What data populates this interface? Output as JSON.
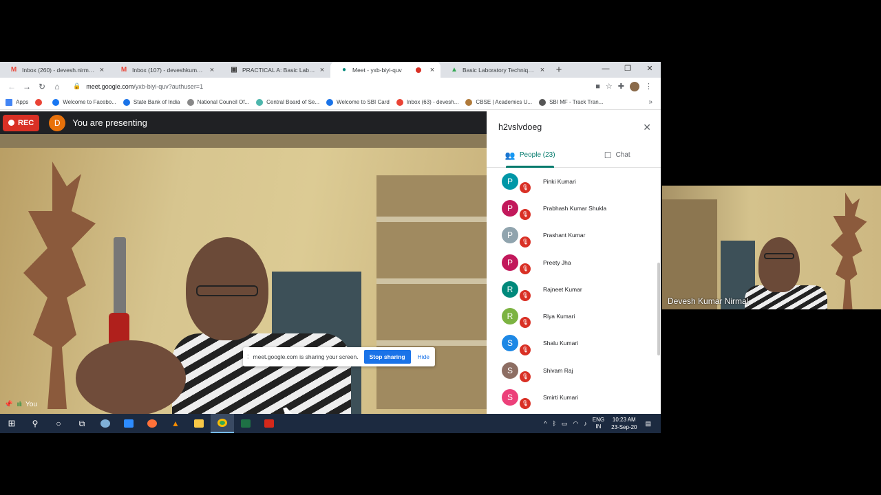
{
  "browser": {
    "tabs": [
      {
        "icon": "gmail-icon",
        "title": "Inbox (260) - devesh.nirmal@g",
        "active": false
      },
      {
        "icon": "gmail-icon",
        "title": "Inbox (107) - deveshkumar.22(",
        "active": false
      },
      {
        "icon": "doc-icon",
        "title": "PRACTICAL A: Basic Laboratory",
        "active": false
      },
      {
        "icon": "meet-icon",
        "title": "Meet - yxb-biyi-quv",
        "active": true,
        "recording": true
      },
      {
        "icon": "drive-icon",
        "title": "Basic Laboratory Techniques (",
        "active": false
      }
    ],
    "url_host": "meet.google.com",
    "url_path": "/yxb-biyi-quv?authuser=1",
    "bookmarks": [
      {
        "label": "Apps",
        "color": "#4285f4"
      },
      {
        "label": "",
        "color": "#ea4335"
      },
      {
        "label": "Welcome to Facebo...",
        "color": "#1877f2"
      },
      {
        "label": "State Bank of India",
        "color": "#1a73e8"
      },
      {
        "label": "National Council Of...",
        "color": "#888888"
      },
      {
        "label": "Central Board of Se...",
        "color": "#4db6ac"
      },
      {
        "label": "Welcome to SBI Card",
        "color": "#1a73e8"
      },
      {
        "label": "Inbox (63) - devesh...",
        "color": "#ea4335"
      },
      {
        "label": "CBSE | Academics U...",
        "color": "#b07a3a"
      },
      {
        "label": "SBI MF - Track Tran...",
        "color": "#555555"
      }
    ]
  },
  "meet": {
    "rec_label": "REC",
    "presenter_initial": "D",
    "presenting_text": "You are presenting",
    "share_notice": "meet.google.com is sharing your screen.",
    "stop_sharing": "Stop sharing",
    "hide": "Hide",
    "self_label": "You",
    "panel": {
      "meeting_code": "h2vslvdoeg",
      "people_tab": "People (23)",
      "chat_tab": "Chat",
      "participants": [
        {
          "initial": "P",
          "name": "Pinki Kumari",
          "color": "#0097a7"
        },
        {
          "initial": "P",
          "name": "Prabhash Kumar Shukla",
          "color": "#c2185b"
        },
        {
          "initial": "P",
          "name": "Prashant Kumar",
          "color": "#90a4ae"
        },
        {
          "initial": "P",
          "name": "Preety Jha",
          "color": "#c2185b"
        },
        {
          "initial": "R",
          "name": "Rajneet Kumar",
          "color": "#00897b"
        },
        {
          "initial": "R",
          "name": "Riya Kumari",
          "color": "#7cb342"
        },
        {
          "initial": "S",
          "name": "Shalu Kumari",
          "color": "#1e88e5"
        },
        {
          "initial": "S",
          "name": "Shivam Raj",
          "color": "#8d6e63"
        },
        {
          "initial": "S",
          "name": "Smirti Kumari",
          "color": "#ec407a"
        }
      ]
    },
    "side_tile_name": "Devesh Kumar Nirmal"
  },
  "taskbar": {
    "lang_top": "ENG",
    "lang_bottom": "IN",
    "time": "10:23 AM",
    "date": "23-Sep-20"
  }
}
